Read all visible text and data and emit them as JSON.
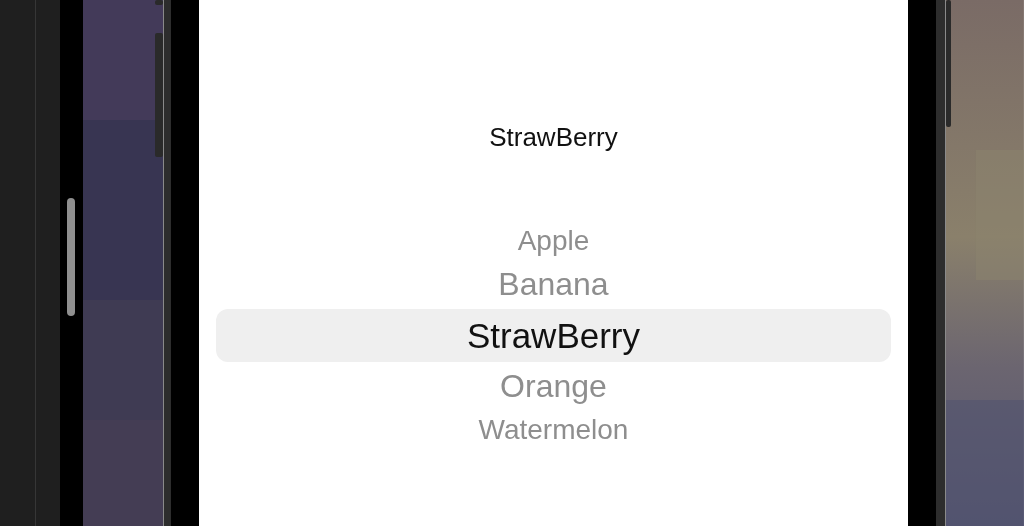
{
  "title_label": "StrawBerry",
  "picker": {
    "items": [
      {
        "label": "Apple",
        "selected": false
      },
      {
        "label": "Banana",
        "selected": false
      },
      {
        "label": "StrawBerry",
        "selected": true
      },
      {
        "label": "Orange",
        "selected": false
      },
      {
        "label": "Watermelon",
        "selected": false
      }
    ]
  }
}
